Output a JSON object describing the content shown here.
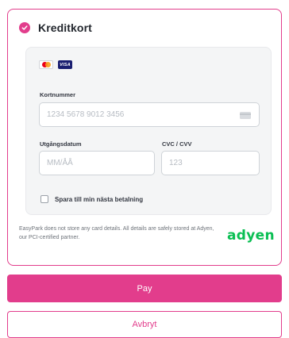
{
  "payment_method": {
    "title": "Kreditkort",
    "brand_icons": [
      "mastercard-icon",
      "visa-icon"
    ],
    "visa_text": "VISA"
  },
  "form": {
    "card_number": {
      "label": "Kortnummer",
      "placeholder": "1234 5678 9012 3456",
      "value": ""
    },
    "expiry": {
      "label": "Utgångsdatum",
      "placeholder": "MM/ÅÅ",
      "value": ""
    },
    "cvc": {
      "label": "CVC / CVV",
      "placeholder": "123",
      "value": ""
    },
    "save_card": {
      "label": "Spara till min nästa betalning",
      "checked": false
    }
  },
  "notice": "EasyPark does not store any card details. All details are safely stored at Adyen, our PCI-certified partner.",
  "provider_logo": "adyen",
  "actions": {
    "pay_label": "Pay",
    "cancel_label": "Avbryt"
  },
  "colors": {
    "accent": "#e23d8c",
    "adyen_green": "#0abf53"
  }
}
